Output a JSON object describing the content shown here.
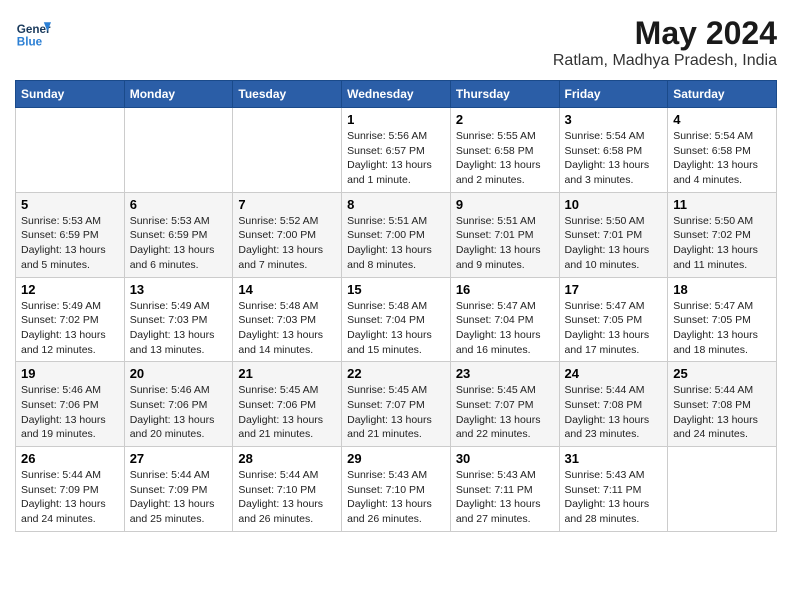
{
  "header": {
    "logo_general": "General",
    "logo_blue": "Blue",
    "title": "May 2024",
    "subtitle": "Ratlam, Madhya Pradesh, India"
  },
  "columns": [
    "Sunday",
    "Monday",
    "Tuesday",
    "Wednesday",
    "Thursday",
    "Friday",
    "Saturday"
  ],
  "weeks": [
    [
      {
        "day": "",
        "info": ""
      },
      {
        "day": "",
        "info": ""
      },
      {
        "day": "",
        "info": ""
      },
      {
        "day": "1",
        "info": "Sunrise: 5:56 AM\nSunset: 6:57 PM\nDaylight: 13 hours\nand 1 minute."
      },
      {
        "day": "2",
        "info": "Sunrise: 5:55 AM\nSunset: 6:58 PM\nDaylight: 13 hours\nand 2 minutes."
      },
      {
        "day": "3",
        "info": "Sunrise: 5:54 AM\nSunset: 6:58 PM\nDaylight: 13 hours\nand 3 minutes."
      },
      {
        "day": "4",
        "info": "Sunrise: 5:54 AM\nSunset: 6:58 PM\nDaylight: 13 hours\nand 4 minutes."
      }
    ],
    [
      {
        "day": "5",
        "info": "Sunrise: 5:53 AM\nSunset: 6:59 PM\nDaylight: 13 hours\nand 5 minutes."
      },
      {
        "day": "6",
        "info": "Sunrise: 5:53 AM\nSunset: 6:59 PM\nDaylight: 13 hours\nand 6 minutes."
      },
      {
        "day": "7",
        "info": "Sunrise: 5:52 AM\nSunset: 7:00 PM\nDaylight: 13 hours\nand 7 minutes."
      },
      {
        "day": "8",
        "info": "Sunrise: 5:51 AM\nSunset: 7:00 PM\nDaylight: 13 hours\nand 8 minutes."
      },
      {
        "day": "9",
        "info": "Sunrise: 5:51 AM\nSunset: 7:01 PM\nDaylight: 13 hours\nand 9 minutes."
      },
      {
        "day": "10",
        "info": "Sunrise: 5:50 AM\nSunset: 7:01 PM\nDaylight: 13 hours\nand 10 minutes."
      },
      {
        "day": "11",
        "info": "Sunrise: 5:50 AM\nSunset: 7:02 PM\nDaylight: 13 hours\nand 11 minutes."
      }
    ],
    [
      {
        "day": "12",
        "info": "Sunrise: 5:49 AM\nSunset: 7:02 PM\nDaylight: 13 hours\nand 12 minutes."
      },
      {
        "day": "13",
        "info": "Sunrise: 5:49 AM\nSunset: 7:03 PM\nDaylight: 13 hours\nand 13 minutes."
      },
      {
        "day": "14",
        "info": "Sunrise: 5:48 AM\nSunset: 7:03 PM\nDaylight: 13 hours\nand 14 minutes."
      },
      {
        "day": "15",
        "info": "Sunrise: 5:48 AM\nSunset: 7:04 PM\nDaylight: 13 hours\nand 15 minutes."
      },
      {
        "day": "16",
        "info": "Sunrise: 5:47 AM\nSunset: 7:04 PM\nDaylight: 13 hours\nand 16 minutes."
      },
      {
        "day": "17",
        "info": "Sunrise: 5:47 AM\nSunset: 7:05 PM\nDaylight: 13 hours\nand 17 minutes."
      },
      {
        "day": "18",
        "info": "Sunrise: 5:47 AM\nSunset: 7:05 PM\nDaylight: 13 hours\nand 18 minutes."
      }
    ],
    [
      {
        "day": "19",
        "info": "Sunrise: 5:46 AM\nSunset: 7:06 PM\nDaylight: 13 hours\nand 19 minutes."
      },
      {
        "day": "20",
        "info": "Sunrise: 5:46 AM\nSunset: 7:06 PM\nDaylight: 13 hours\nand 20 minutes."
      },
      {
        "day": "21",
        "info": "Sunrise: 5:45 AM\nSunset: 7:06 PM\nDaylight: 13 hours\nand 21 minutes."
      },
      {
        "day": "22",
        "info": "Sunrise: 5:45 AM\nSunset: 7:07 PM\nDaylight: 13 hours\nand 21 minutes."
      },
      {
        "day": "23",
        "info": "Sunrise: 5:45 AM\nSunset: 7:07 PM\nDaylight: 13 hours\nand 22 minutes."
      },
      {
        "day": "24",
        "info": "Sunrise: 5:44 AM\nSunset: 7:08 PM\nDaylight: 13 hours\nand 23 minutes."
      },
      {
        "day": "25",
        "info": "Sunrise: 5:44 AM\nSunset: 7:08 PM\nDaylight: 13 hours\nand 24 minutes."
      }
    ],
    [
      {
        "day": "26",
        "info": "Sunrise: 5:44 AM\nSunset: 7:09 PM\nDaylight: 13 hours\nand 24 minutes."
      },
      {
        "day": "27",
        "info": "Sunrise: 5:44 AM\nSunset: 7:09 PM\nDaylight: 13 hours\nand 25 minutes."
      },
      {
        "day": "28",
        "info": "Sunrise: 5:44 AM\nSunset: 7:10 PM\nDaylight: 13 hours\nand 26 minutes."
      },
      {
        "day": "29",
        "info": "Sunrise: 5:43 AM\nSunset: 7:10 PM\nDaylight: 13 hours\nand 26 minutes."
      },
      {
        "day": "30",
        "info": "Sunrise: 5:43 AM\nSunset: 7:11 PM\nDaylight: 13 hours\nand 27 minutes."
      },
      {
        "day": "31",
        "info": "Sunrise: 5:43 AM\nSunset: 7:11 PM\nDaylight: 13 hours\nand 28 minutes."
      },
      {
        "day": "",
        "info": ""
      }
    ]
  ]
}
